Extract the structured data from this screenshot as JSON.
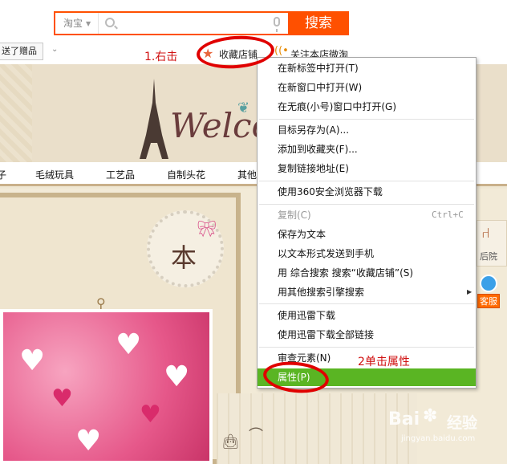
{
  "search": {
    "scope": "淘宝",
    "button": "搜索",
    "placeholder": ""
  },
  "shop_toolbar": {
    "gift": "送了赠品",
    "favorite": "收藏店铺",
    "follow": "关注本店微淘"
  },
  "annotations": {
    "step1": "1.右击",
    "step2": "2单击属性"
  },
  "banner": {
    "welcome": "Welco",
    "nav": [
      "子",
      "毛绒玩具",
      "工艺品",
      "自制头花",
      "其他"
    ]
  },
  "content": {
    "ben": "本",
    "side_tab": "后院",
    "service": "客服"
  },
  "context_menu": {
    "items": [
      {
        "label": "在新标签中打开(T)",
        "disabled": false
      },
      {
        "label": "在新窗口中打开(W)",
        "disabled": false
      },
      {
        "label": "在无痕(小号)窗口中打开(G)",
        "disabled": false
      },
      {
        "label": "目标另存为(A)...",
        "disabled": false
      },
      {
        "label": "添加到收藏夹(F)...",
        "disabled": false
      },
      {
        "label": "复制链接地址(E)",
        "disabled": false
      },
      {
        "label": "使用360安全浏览器下载",
        "disabled": false
      },
      {
        "label": "复制(C)",
        "disabled": true,
        "shortcut": "Ctrl+C"
      },
      {
        "label": "保存为文本",
        "disabled": false
      },
      {
        "label": "以文本形式发送到手机",
        "disabled": false
      },
      {
        "label": "用 综合搜索 搜索“收藏店铺”(S)",
        "disabled": false
      },
      {
        "label": "用其他搜索引擎搜索",
        "disabled": false
      },
      {
        "label": "使用迅雷下载",
        "disabled": false
      },
      {
        "label": "使用迅雷下载全部链接",
        "disabled": false
      },
      {
        "label": "审查元素(N)",
        "disabled": false
      },
      {
        "label": "属性(P)",
        "disabled": false,
        "active": true
      }
    ]
  },
  "watermark": {
    "brand": "Bai",
    "brand_cn": "经验",
    "url": "jingyan.baidu.com"
  },
  "colors": {
    "accent": "#ff5000",
    "menu_highlight": "#5ab523",
    "annotation_red": "#e00000"
  },
  "icons": {
    "search": "search-icon",
    "mic": "mic-icon",
    "star": "star-icon",
    "weibo": "weibo-icon"
  }
}
